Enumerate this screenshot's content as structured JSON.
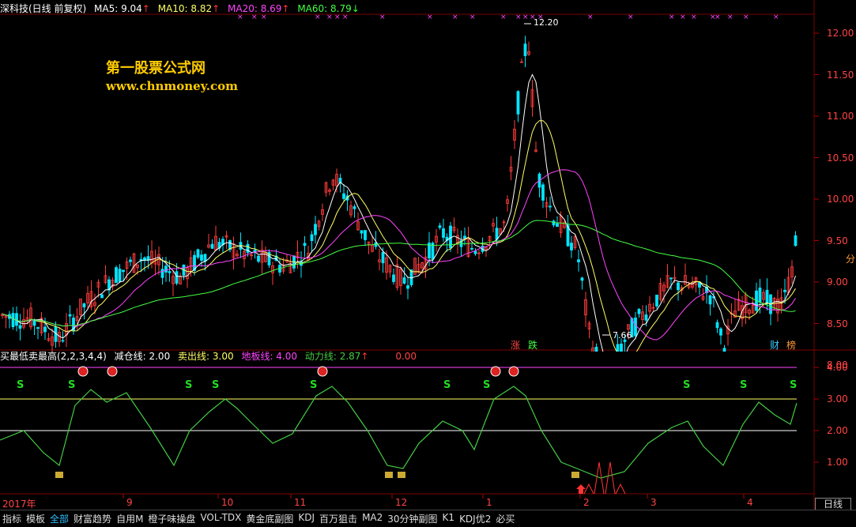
{
  "main_header": {
    "title": "深科技(日线 前复权)",
    "ma5_label": "MA5: 9.04",
    "ma10_label": "MA10: 8.82",
    "ma20_label": "MA20: 8.69",
    "ma60_label": "MA60: 8.79"
  },
  "watermark": {
    "line1": "第一股票公式网",
    "line2": "www.chnmoney.com"
  },
  "price_axis": [
    "12.00",
    "11.50",
    "11.00",
    "10.50",
    "10.00",
    "9.50",
    "9.00",
    "8.50",
    "8.00"
  ],
  "annotations": {
    "high": "12.20",
    "low": "7.66",
    "zhang": "涨",
    "die": "跌",
    "cai": "财",
    "bang": "榜",
    "fen": "分"
  },
  "indicator_header": {
    "name": "买最低卖最高(2,2,3,4,4)",
    "reduce": "减仓线: 2.00",
    "sell": "卖出线: 3.00",
    "floor": "地板线: 4.00",
    "power": "动力线: 2.87",
    "extra": "0.00"
  },
  "indicator_axis": [
    "4.00",
    "3.00",
    "2.00",
    "1.00"
  ],
  "signal_s": "S",
  "time_axis": [
    "2017年",
    "9",
    "10",
    "11",
    "12",
    "1",
    "2",
    "3",
    "4"
  ],
  "period_button": "日线",
  "tabs": [
    "指标",
    "模板",
    "全部",
    "财富趋势",
    "自用M",
    "橙子味操盘",
    "VOL-TDX",
    "黄金底副图",
    "KDJ",
    "百万狙击",
    "MA2",
    "30分钟副图",
    "K1",
    "KDJ优2",
    "必买"
  ],
  "active_tab": "全部",
  "colors": {
    "up": "#ff3c3c",
    "down": "#00e5ff",
    "ma5": "#ffffff",
    "ma10": "#ffff66",
    "ma20": "#ff44ff",
    "ma60": "#44ff44",
    "power": "#44cc44"
  }
}
